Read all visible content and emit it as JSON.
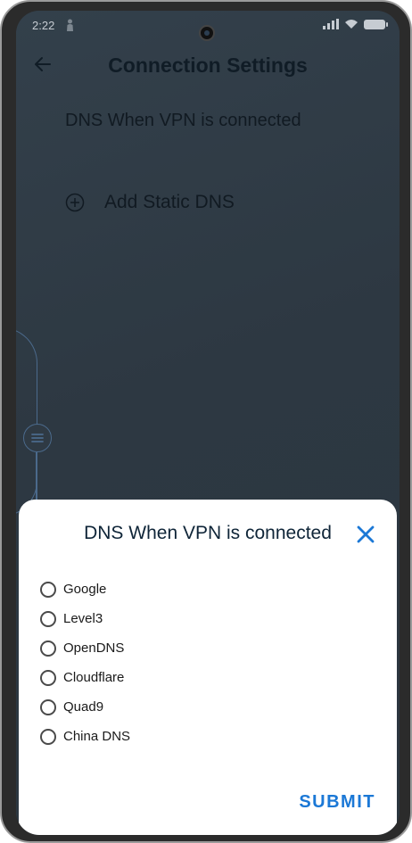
{
  "status_bar": {
    "time": "2:22",
    "icons": [
      "person-icon",
      "signal-icon",
      "wifi-icon",
      "battery-icon"
    ]
  },
  "header": {
    "title": "Connection Settings",
    "back_icon": "arrow-left-icon"
  },
  "main": {
    "section_label": "DNS When VPN is connected",
    "add_static_dns": "Add Static DNS",
    "add_icon": "plus-circle-icon"
  },
  "sheet": {
    "title": "DNS When VPN is connected",
    "close_icon": "close-icon",
    "options": [
      {
        "label": "Google",
        "selected": false
      },
      {
        "label": "Level3",
        "selected": false
      },
      {
        "label": "OpenDNS",
        "selected": false
      },
      {
        "label": "Cloudflare",
        "selected": false
      },
      {
        "label": "Quad9",
        "selected": false
      },
      {
        "label": "China DNS",
        "selected": false
      }
    ],
    "submit_label": "SUBMIT"
  },
  "colors": {
    "accent": "#1b78d6",
    "overlay_bg": "#2f3a44",
    "sheet_bg": "#ffffff"
  }
}
